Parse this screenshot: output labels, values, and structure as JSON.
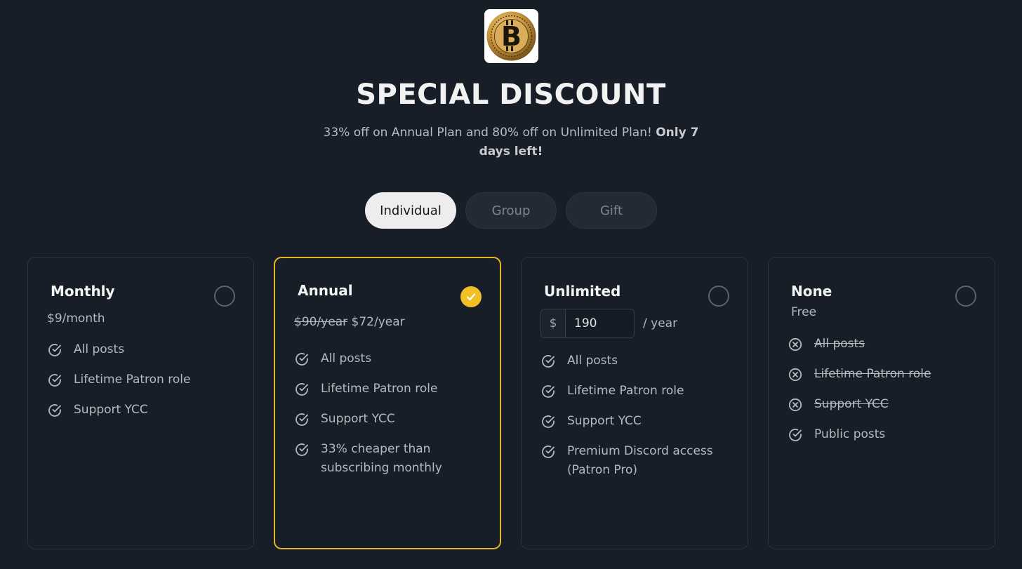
{
  "header": {
    "title": "SPECIAL DISCOUNT",
    "subtitle_plain": "33% off on Annual Plan and 80% off on Unlimited Plan!",
    "subtitle_bold": "Only 7 days left!"
  },
  "tabs": [
    {
      "label": "Individual",
      "active": true
    },
    {
      "label": "Group",
      "active": false
    },
    {
      "label": "Gift",
      "active": false
    }
  ],
  "plans": [
    {
      "name": "Monthly",
      "price": "$9/month",
      "selected": false,
      "features": [
        {
          "text": "All posts",
          "included": true
        },
        {
          "text": "Lifetime Patron role",
          "included": true
        },
        {
          "text": "Support YCC",
          "included": true
        }
      ]
    },
    {
      "name": "Annual",
      "old_price": "$90/year",
      "price": "$72/year",
      "selected": true,
      "features": [
        {
          "text": "All posts",
          "included": true
        },
        {
          "text": "Lifetime Patron role",
          "included": true
        },
        {
          "text": "Support YCC",
          "included": true
        },
        {
          "text": "33% cheaper than subscribing monthly",
          "included": true
        }
      ]
    },
    {
      "name": "Unlimited",
      "currency_prefix": "$",
      "amount_value": "190",
      "period": "/ year",
      "selected": false,
      "features": [
        {
          "text": "All posts",
          "included": true
        },
        {
          "text": "Lifetime Patron role",
          "included": true
        },
        {
          "text": "Support YCC",
          "included": true
        },
        {
          "text": "Premium Discord access (Patron Pro)",
          "included": true
        }
      ]
    },
    {
      "name": "None",
      "price": "Free",
      "selected": false,
      "features": [
        {
          "text": "All posts",
          "included": false
        },
        {
          "text": "Lifetime Patron role",
          "included": false
        },
        {
          "text": "Support YCC",
          "included": false
        },
        {
          "text": "Public posts",
          "included": true
        }
      ]
    }
  ],
  "colors": {
    "background": "#181e28",
    "accent_selected": "#f2bf26",
    "card_border": "#2c3340"
  }
}
